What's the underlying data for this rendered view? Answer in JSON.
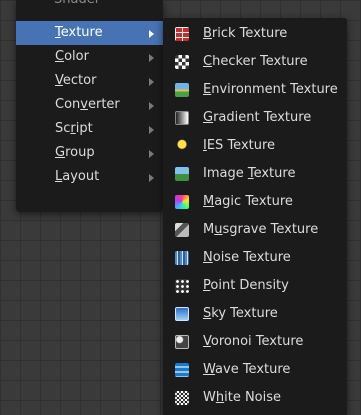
{
  "menu": {
    "cut_off_item": "Shader",
    "items": [
      {
        "pre": "",
        "u": "T",
        "post": "exture",
        "active": true
      },
      {
        "pre": "",
        "u": "C",
        "post": "olor"
      },
      {
        "pre": "",
        "u": "V",
        "post": "ector"
      },
      {
        "pre": "Con",
        "u": "v",
        "post": "erter"
      },
      {
        "pre": "Sc",
        "u": "r",
        "post": "ipt"
      },
      {
        "pre": "",
        "u": "G",
        "post": "roup"
      },
      {
        "pre": "",
        "u": "L",
        "post": "ayout"
      }
    ]
  },
  "submenu": {
    "items": [
      {
        "pre": "",
        "u": "B",
        "post": "rick Texture",
        "icon": "brick-texture-icon"
      },
      {
        "pre": "",
        "u": "C",
        "post": "hecker Texture",
        "icon": "checker-texture-icon"
      },
      {
        "pre": "",
        "u": "E",
        "post": "nvironment Texture",
        "icon": "environment-texture-icon"
      },
      {
        "pre": "",
        "u": "G",
        "post": "radient Texture",
        "icon": "gradient-texture-icon"
      },
      {
        "pre": "",
        "u": "I",
        "post": "ES Texture",
        "icon": "ies-texture-icon"
      },
      {
        "pre": "Image ",
        "u": "T",
        "post": "exture",
        "icon": "image-texture-icon"
      },
      {
        "pre": "",
        "u": "M",
        "post": "agic Texture",
        "icon": "magic-texture-icon"
      },
      {
        "pre": "M",
        "u": "u",
        "post": "sgrave Texture",
        "icon": "musgrave-texture-icon"
      },
      {
        "pre": "",
        "u": "N",
        "post": "oise Texture",
        "icon": "noise-texture-icon"
      },
      {
        "pre": "",
        "u": "P",
        "post": "oint Density",
        "icon": "point-density-icon"
      },
      {
        "pre": "",
        "u": "S",
        "post": "ky Texture",
        "icon": "sky-texture-icon"
      },
      {
        "pre": "",
        "u": "V",
        "post": "oronoi Texture",
        "icon": "voronoi-texture-icon"
      },
      {
        "pre": "",
        "u": "W",
        "post": "ave Texture",
        "icon": "wave-texture-icon"
      },
      {
        "pre": "W",
        "u": "h",
        "post": "ite Noise",
        "icon": "white-noise-icon"
      }
    ]
  },
  "colors": {
    "highlight": "#4772b3",
    "menu_bg": "#1b1b1b",
    "text": "#dcdcdc"
  }
}
